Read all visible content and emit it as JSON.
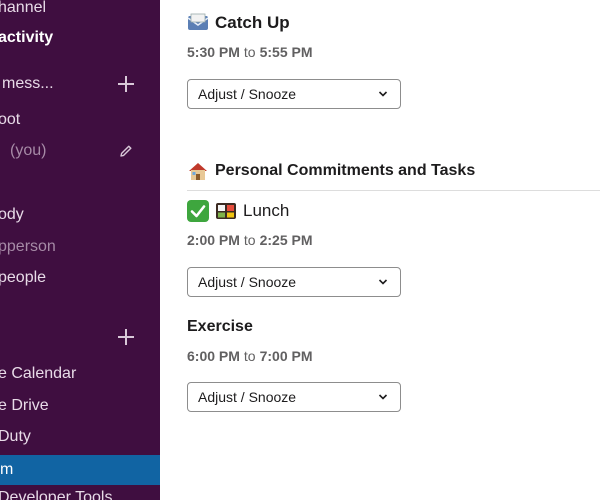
{
  "sidebar": {
    "items": [
      {
        "label": "hannel"
      },
      {
        "label": "activity"
      },
      {
        "label": "mess..."
      },
      {
        "label": "oot"
      },
      {
        "label": "(you)"
      },
      {
        "label": "ody"
      },
      {
        "label": "pperson"
      },
      {
        "label": "people"
      },
      {
        "label": "e Calendar"
      },
      {
        "label": "e Drive"
      },
      {
        "label": "Duty"
      },
      {
        "label": "m"
      },
      {
        "label": "Developer Tools"
      }
    ]
  },
  "events": [
    {
      "title": "Catch Up",
      "icon": "envelope-icon",
      "start": "5:30 PM",
      "sep": "to",
      "end": "5:55 PM",
      "dropdown": "Adjust / Snooze"
    }
  ],
  "section": {
    "title": "Personal Commitments and Tasks",
    "icon": "house-icon"
  },
  "tasks": [
    {
      "title": "Lunch",
      "icons": [
        "check-mark-icon",
        "bento-box-icon"
      ],
      "start": "2:00 PM",
      "sep": "to",
      "end": "2:25 PM",
      "dropdown": "Adjust / Snooze"
    },
    {
      "title": "Exercise",
      "start": "6:00 PM",
      "sep": "to",
      "end": "7:00 PM",
      "dropdown": "Adjust / Snooze"
    }
  ],
  "colors": {
    "sidebar_bg": "#3f0e40",
    "selected_bg": "#1164a3",
    "check_green": "#3ea63e"
  }
}
